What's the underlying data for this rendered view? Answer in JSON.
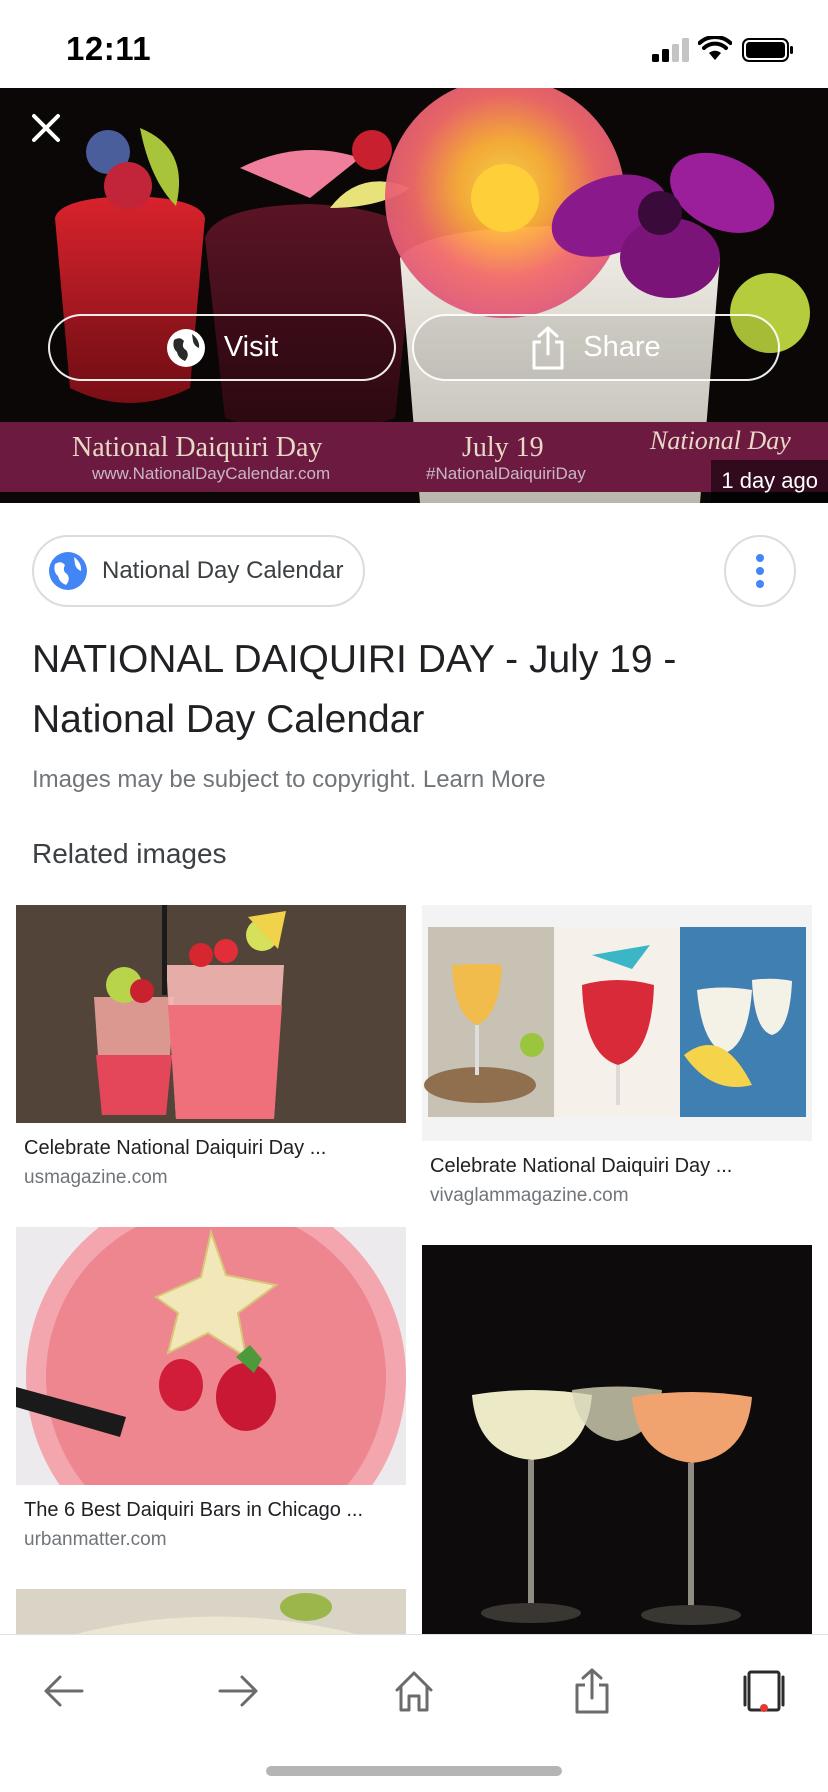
{
  "status_bar": {
    "time": "12:11"
  },
  "hero": {
    "visit_label": "Visit",
    "share_label": "Share",
    "banner_title": "National Daiquiri Day",
    "banner_url": "www.NationalDayCalendar.com",
    "banner_date": "July 19",
    "banner_hashtag": "#NationalDaiquiriDay",
    "banner_logo": "National Day",
    "time_ago": "1 day ago"
  },
  "source": {
    "name": "National Day Calendar"
  },
  "page_title": "NATIONAL DAIQUIRI DAY - July 19 - National Day Calendar",
  "copyright": {
    "text": "Images may be subject to copyright.",
    "link": "Learn More"
  },
  "related": {
    "heading": "Related images",
    "items": [
      {
        "title": "Celebrate National Daiquiri Day ...",
        "domain": "usmagazine.com"
      },
      {
        "title": "Celebrate National Daiquiri Day ...",
        "domain": "vivaglammagazine.com"
      },
      {
        "title": "The 6 Best Daiquiri Bars in Chicago ...",
        "domain": "urbanmatter.com"
      },
      {
        "title": "",
        "domain": ""
      }
    ]
  },
  "toolbar": {
    "icons": [
      "back-icon",
      "forward-icon",
      "home-icon",
      "share-icon",
      "tabs-icon"
    ]
  },
  "colors": {
    "banner": "#6d1a40",
    "accent_blue": "#4285f4",
    "notification_dot": "#e53935"
  }
}
